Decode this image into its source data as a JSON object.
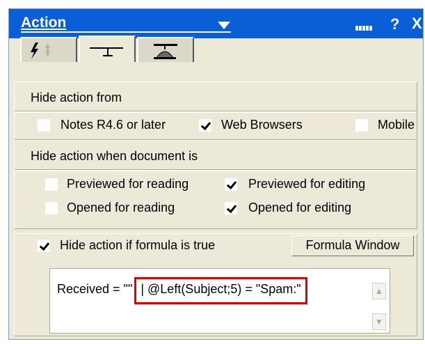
{
  "window": {
    "title": "Action",
    "help_glyph": "?",
    "close_glyph": "X"
  },
  "tabs": [
    {
      "name": "tab-info",
      "icon": "lightning-icon"
    },
    {
      "name": "tab-hide-when",
      "icon": "hide-when-icon",
      "selected": true
    },
    {
      "name": "tab-advanced",
      "icon": "propeller-hat-icon"
    }
  ],
  "hide_from": {
    "heading": "Hide action from",
    "options": [
      {
        "label": "Notes R4.6 or later",
        "checked": false
      },
      {
        "label": "Web Browsers",
        "checked": true
      },
      {
        "label": "Mobile",
        "checked": false
      }
    ]
  },
  "hide_when": {
    "heading": "Hide action when document is",
    "options": [
      {
        "label": "Previewed for reading",
        "checked": false
      },
      {
        "label": "Previewed for editing",
        "checked": true
      },
      {
        "label": "Opened for reading",
        "checked": false
      },
      {
        "label": "Opened for editing",
        "checked": true
      }
    ]
  },
  "formula": {
    "checkbox_label": "Hide action if formula is true",
    "checked": true,
    "window_button": "Formula Window",
    "text_before": "Received = \"\"",
    "text_highlighted": "| @Left(Subject;5) = \"Spam:\""
  }
}
